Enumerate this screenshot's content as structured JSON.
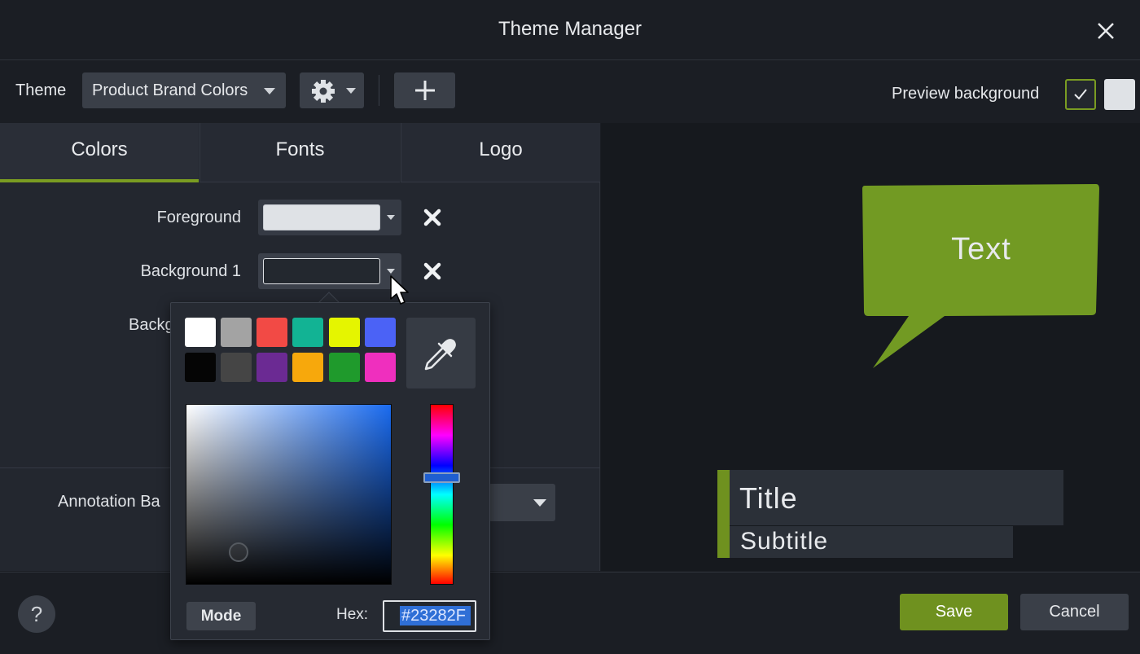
{
  "window": {
    "title": "Theme Manager"
  },
  "toolbar": {
    "theme_label": "Theme",
    "theme_value": "Product Brand Colors",
    "preview_background_label": "Preview background",
    "preview_swatch_color": "#dfe2e6"
  },
  "tabs": [
    {
      "label": "Colors",
      "active": true
    },
    {
      "label": "Fonts",
      "active": false
    },
    {
      "label": "Logo",
      "active": false
    }
  ],
  "colors": {
    "foreground_label": "Foreground",
    "foreground_color": "#dfe2e6",
    "background1_label": "Background 1",
    "background1_color": "#23282f",
    "background2_label": "Backg",
    "annotation_label": "Annotation Ba"
  },
  "picker": {
    "presets": [
      "#ffffff",
      "#a3a3a3",
      "#f24a45",
      "#12b394",
      "#e5f500",
      "#4b62f6",
      "#050505",
      "#454545",
      "#6b2a93",
      "#f7a80c",
      "#1f9a2c",
      "#ef2fbe"
    ],
    "mode_label": "Mode",
    "hex_label": "Hex:",
    "hex_value": "#23282F"
  },
  "preview": {
    "callout_text": "Text",
    "callout_color": "#729a23",
    "lower_third_title": "Title",
    "lower_third_subtitle": "Subtitle",
    "accent_color": "#6f911f"
  },
  "footer": {
    "help_label": "?",
    "save_label": "Save",
    "cancel_label": "Cancel"
  }
}
